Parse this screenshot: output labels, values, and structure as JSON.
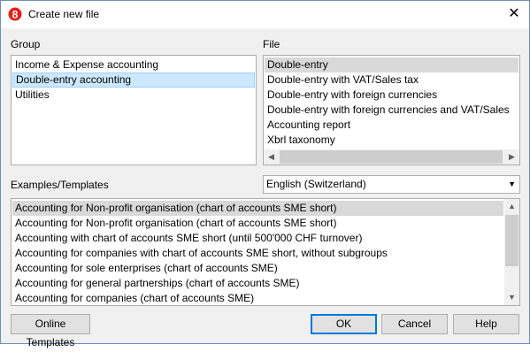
{
  "window": {
    "title": "Create new file",
    "close_glyph": "✕"
  },
  "group": {
    "label": "Group",
    "items": [
      "Income & Expense accounting",
      "Double-entry accounting",
      "Utilities"
    ],
    "selected_index": 1
  },
  "file": {
    "label": "File",
    "items": [
      "Double-entry",
      "Double-entry with VAT/Sales tax",
      "Double-entry with foreign currencies",
      "Double-entry with foreign currencies and VAT/Sales",
      "Accounting report",
      "Xbrl taxonomy"
    ],
    "selected_index": 0
  },
  "examples": {
    "label": "Examples/Templates",
    "language_selected": "English (Switzerland)",
    "items": [
      "Accounting for Non-profit organisation (chart of accounts SME short)",
      "Accounting for Non-profit organisation (chart of accounts SME short)",
      "Accounting with chart of accounts SME short (until 500'000 CHF turnover)",
      "Accounting for companies with chart of accounts SME short, without subgroups",
      "Accounting for sole enterprises (chart of accounts SME)",
      "Accounting for general partnerships (chart of accounts SME)",
      "Accounting for companies (chart of accounts SME)"
    ],
    "selected_index": 0
  },
  "buttons": {
    "online_templates": "Online Templates",
    "ok": "OK",
    "cancel": "Cancel",
    "help": "Help"
  },
  "icons": {
    "app": "banana-app-icon",
    "close": "close-icon",
    "left_arrow": "◀",
    "right_arrow": "▶",
    "up_arrow": "▲",
    "down_arrow": "▼"
  },
  "colors": {
    "brand_red": "#e2231a",
    "selection_blue": "#cce8ff",
    "selection_gray": "#d9d9d9",
    "default_button_border": "#0078d7"
  }
}
